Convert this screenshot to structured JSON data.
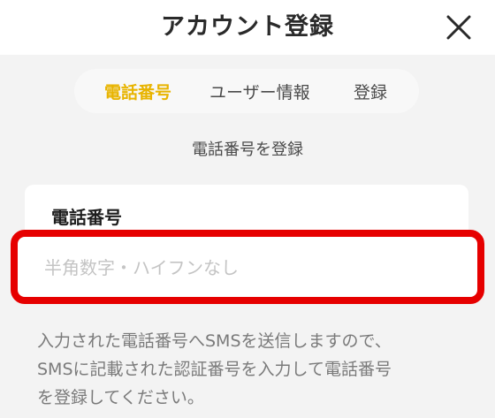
{
  "header": {
    "title": "アカウント登録",
    "close_icon": "close-icon"
  },
  "steps": [
    {
      "label": "電話番号",
      "active": true
    },
    {
      "label": "ユーザー情報",
      "active": false
    },
    {
      "label": "登録",
      "active": false
    }
  ],
  "subtitle": "電話番号を登録",
  "form": {
    "label": "電話番号",
    "value": "",
    "placeholder": "半角数字・ハイフンなし"
  },
  "help_lines": [
    "入力された電話番号へSMSを送信しますので、",
    "SMSに記載された認証番号を入力して電話番号",
    "を登録してください。"
  ],
  "colors": {
    "accent": "#e8b400",
    "highlight": "#e60000",
    "background": "#f3f3f3"
  }
}
